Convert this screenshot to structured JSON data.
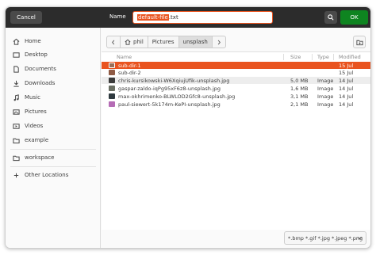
{
  "header": {
    "cancel_label": "Cancel",
    "name_label": "Name",
    "filename_selected": "default-file",
    "filename_ext": ".txt",
    "ok_label": "OK"
  },
  "sidebar": {
    "items": [
      {
        "label": "Home",
        "icon": "home-icon"
      },
      {
        "label": "Desktop",
        "icon": "desktop-icon"
      },
      {
        "label": "Documents",
        "icon": "documents-icon"
      },
      {
        "label": "Downloads",
        "icon": "downloads-icon"
      },
      {
        "label": "Music",
        "icon": "music-icon"
      },
      {
        "label": "Pictures",
        "icon": "pictures-icon"
      },
      {
        "label": "Videos",
        "icon": "videos-icon"
      },
      {
        "label": "example",
        "icon": "folder-icon"
      },
      {
        "label": "workspace",
        "icon": "folder-icon"
      },
      {
        "label": "Other Locations",
        "icon": "plus-icon"
      }
    ]
  },
  "pathbar": {
    "crumbs": [
      "phil",
      "Pictures",
      "unsplash"
    ]
  },
  "columns": {
    "name": "Name",
    "size": "Size",
    "type": "Type",
    "modified": "Modified"
  },
  "files": [
    {
      "name": "sub-dir-1",
      "size": "",
      "type": "",
      "modified": "15 Jul",
      "kind": "folder"
    },
    {
      "name": "sub-dir-2",
      "size": "",
      "type": "",
      "modified": "15 Jul",
      "kind": "folder"
    },
    {
      "name": "chris-kursikowski-W6XqiujUfik-unsplash.jpg",
      "size": "5,0 MB",
      "type": "Image",
      "modified": "14 Jul",
      "kind": "image"
    },
    {
      "name": "gaspar-zaldo-iqPg95xF6z8-unsplash.jpg",
      "size": "1,6 MB",
      "type": "Image",
      "modified": "14 Jul",
      "kind": "image"
    },
    {
      "name": "max-okhrimenko-BLWLOD2Gfc8-unsplash.jpg",
      "size": "3,1 MB",
      "type": "Image",
      "modified": "14 Jul",
      "kind": "image"
    },
    {
      "name": "paul-siewert-5k174m-KePI-unsplash.jpg",
      "size": "2,1 MB",
      "type": "Image",
      "modified": "14 Jul",
      "kind": "image"
    }
  ],
  "filter": {
    "label": "*.bmp *.gif *.jpg *.jpeg *.png"
  },
  "colors": {
    "accent": "#e95420",
    "ok": "#0e8420",
    "header": "#2c2c2c"
  }
}
